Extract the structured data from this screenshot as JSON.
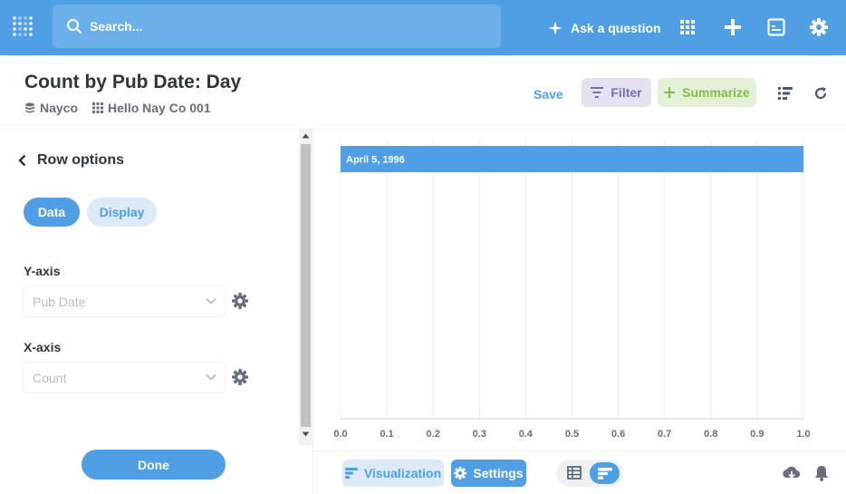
{
  "nav": {
    "search_placeholder": "Search...",
    "ask_label": "Ask a question",
    "brand_color": "#509ee3"
  },
  "header": {
    "title": "Count by Pub Date: Day",
    "database": "Nayco",
    "table": "Hello Nay Co 001",
    "save_label": "Save",
    "filter_label": "Filter",
    "summarize_label": "Summarize"
  },
  "sidebar": {
    "back_label": "Row options",
    "tabs": [
      {
        "label": "Data",
        "active": true
      },
      {
        "label": "Display",
        "active": false
      }
    ],
    "y_axis": {
      "label": "Y-axis",
      "value": "Pub Date"
    },
    "x_axis": {
      "label": "X-axis",
      "value": "Count"
    },
    "done_label": "Done"
  },
  "chart_data": {
    "type": "bar",
    "orientation": "horizontal",
    "categories": [
      "April 5, 1996"
    ],
    "values": [
      1
    ],
    "xlim": [
      0,
      1
    ],
    "x_ticks": [
      "0.0",
      "0.1",
      "0.2",
      "0.3",
      "0.4",
      "0.5",
      "0.6",
      "0.7",
      "0.8",
      "0.9",
      "1.0"
    ],
    "grid": true,
    "bar_color": "#509ee3"
  },
  "footer": {
    "visualization_label": "Visualization",
    "settings_label": "Settings"
  }
}
